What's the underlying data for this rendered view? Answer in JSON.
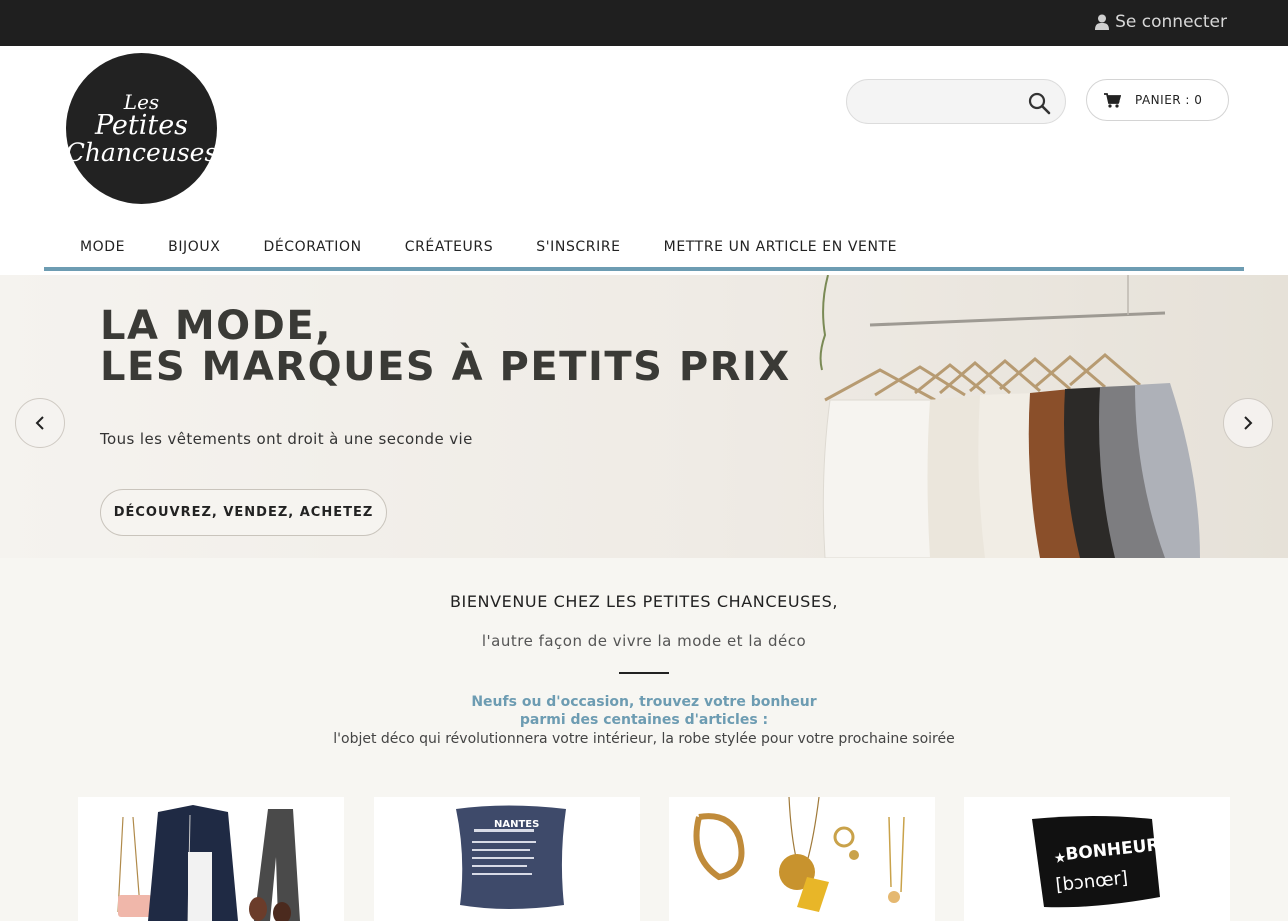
{
  "topbar": {
    "login_label": "Se connecter"
  },
  "logo": {
    "line1": "Les",
    "line2": "Petites",
    "line3": "Chanceuses"
  },
  "search": {
    "placeholder": "",
    "value": ""
  },
  "cart": {
    "label": "PANIER : 0"
  },
  "nav": {
    "items": [
      "MODE",
      "BIJOUX",
      "DÉCORATION",
      "CRÉATEURS",
      "S'INSCRIRE",
      "METTRE UN ARTICLE EN VENTE"
    ]
  },
  "hero": {
    "title_line1": "LA MODE,",
    "title_line2": "LES MARQUES À PETITS PRIX",
    "subtitle": "Tous les vêtements ont droit à une seconde vie",
    "cta_label": "DÉCOUVREZ, VENDEZ, ACHETEZ"
  },
  "intro": {
    "title": "BIENVENUE CHEZ LES PETITES CHANCEUSES,",
    "subtitle": "l'autre façon de vivre la mode et la déco",
    "highlight_line1": "Neufs ou d'occasion, trouvez votre bonheur",
    "highlight_line2": "parmi des centaines d'articles :",
    "description": "l'objet déco qui révolutionnera votre intérieur, la robe stylée pour votre prochaine soirée"
  },
  "tiles": {
    "pillow_text": "NANTES",
    "pouch_line1": "BONHEUR",
    "pouch_line2": "[bɔnœr]"
  },
  "colors": {
    "accent": "#6d9cb2",
    "dark": "#1f1f1f"
  }
}
